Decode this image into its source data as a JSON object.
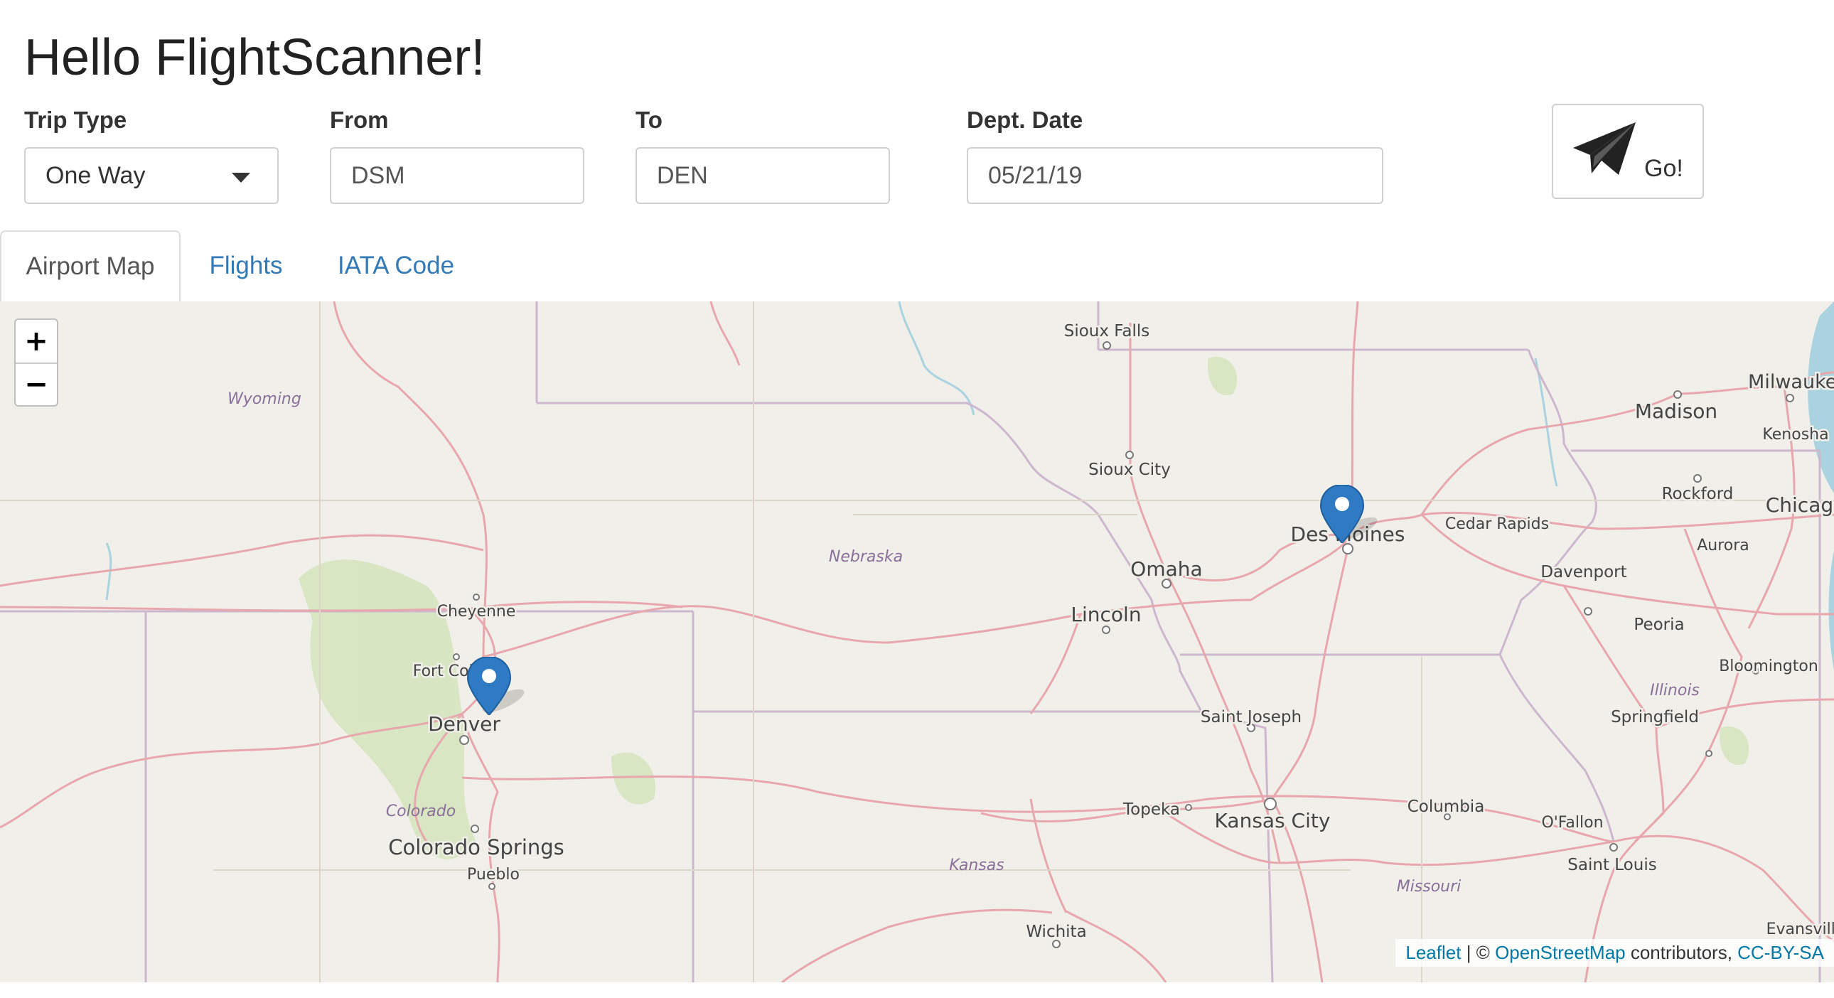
{
  "app": {
    "title": "Hello FlightScanner!"
  },
  "form": {
    "trip_type": {
      "label": "Trip Type",
      "value": "One Way"
    },
    "from": {
      "label": "From",
      "value": "DSM"
    },
    "to": {
      "label": "To",
      "value": "DEN"
    },
    "date": {
      "label": "Dept. Date",
      "value": "05/21/19"
    },
    "go": {
      "label": "Go!",
      "icon": "paper-plane-icon"
    }
  },
  "tabs": [
    {
      "label": "Airport Map",
      "active": true
    },
    {
      "label": "Flights",
      "active": false
    },
    {
      "label": "IATA Code",
      "active": false
    }
  ],
  "map": {
    "zoom_in": "+",
    "zoom_out": "−",
    "states": [
      "Wyoming",
      "Nebraska",
      "Colorado",
      "Kansas",
      "Illinois",
      "Missouri"
    ],
    "cities": {
      "sioux_falls": "Sioux Falls",
      "sioux_city": "Sioux City",
      "omaha": "Omaha",
      "lincoln": "Lincoln",
      "des_moines": "Des Moines",
      "cedar_rapids": "Cedar Rapids",
      "davenport": "Davenport",
      "madison": "Madison",
      "milwaukee": "Milwaukee",
      "kenosha": "Kenosha",
      "rockford": "Rockford",
      "chicago": "Chicago",
      "aurora": "Aurora",
      "peoria": "Peoria",
      "bloomington": "Bloomington",
      "springfield": "Springfield",
      "cheyenne": "Cheyenne",
      "fort_collins": "Fort Collins",
      "denver": "Denver",
      "colorado_springs": "Colorado Springs",
      "pueblo": "Pueblo",
      "saint_joseph": "Saint Joseph",
      "kansas_city": "Kansas City",
      "topeka": "Topeka",
      "columbia": "Columbia",
      "ofallon": "O'Fallon",
      "saint_louis": "Saint Louis",
      "wichita": "Wichita",
      "evansville": "Evansville"
    },
    "markers": [
      "DSM",
      "DEN"
    ],
    "attribution": {
      "leaflet": "Leaflet",
      "sep": " | © ",
      "osm": "OpenStreetMap",
      "contrib": " contributors, ",
      "license": "CC-BY-SA"
    },
    "colors": {
      "land": "#f1efe9",
      "road": "#e7a0a7",
      "border": "#c9b3c9",
      "water": "#aad3df",
      "forest": "#cfe3b4",
      "marker": "#2e7bc4"
    }
  }
}
